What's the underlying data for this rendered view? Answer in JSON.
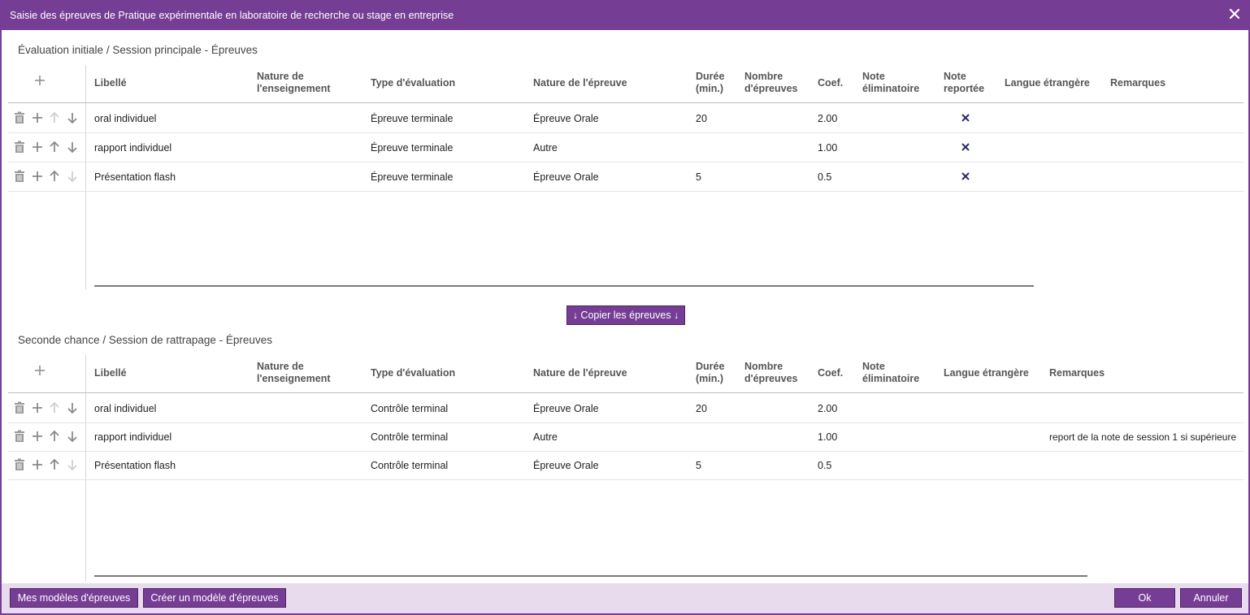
{
  "window": {
    "title": "Saisie des épreuves de Pratique expérimentale en laboratoire de recherche ou stage en entreprise"
  },
  "section1": {
    "title": "Évaluation initiale / Session principale - Épreuves",
    "headers": {
      "libelle": "Libellé",
      "nature_ens_1": "Nature de",
      "nature_ens_2": "l'enseignement",
      "type_eval": "Type d'évaluation",
      "nature_epreuve": "Nature de l'épreuve",
      "duree_1": "Durée",
      "duree_2": "(min.)",
      "nombre_1": "Nombre",
      "nombre_2": "d'épreuves",
      "coef": "Coef.",
      "note_elim_1": "Note",
      "note_elim_2": "éliminatoire",
      "note_rep_1": "Note",
      "note_rep_2": "reportée",
      "langue": "Langue étrangère",
      "remarques": "Remarques"
    },
    "rows": [
      {
        "libelle": "oral individuel",
        "nature_ens": "",
        "type_eval": "Épreuve terminale",
        "nature_epreuve": "Épreuve Orale",
        "duree": "20",
        "nombre": "",
        "coef": "2.00",
        "note_elim": "",
        "langue": "",
        "remarques": ""
      },
      {
        "libelle": "rapport individuel",
        "nature_ens": "",
        "type_eval": "Épreuve terminale",
        "nature_epreuve": "Autre",
        "duree": "",
        "nombre": "",
        "coef": "1.00",
        "note_elim": "",
        "langue": "",
        "remarques": ""
      },
      {
        "libelle": "Présentation flash",
        "nature_ens": "",
        "type_eval": "Épreuve terminale",
        "nature_epreuve": "Épreuve Orale",
        "duree": "5",
        "nombre": "",
        "coef": "0.5",
        "note_elim": "",
        "langue": "",
        "remarques": ""
      }
    ]
  },
  "copy_button": "↓ Copier les épreuves ↓",
  "section2": {
    "title": "Seconde chance / Session de rattrapage - Épreuves",
    "headers": {
      "libelle": "Libellé",
      "nature_ens_1": "Nature de",
      "nature_ens_2": "l'enseignement",
      "type_eval": "Type d'évaluation",
      "nature_epreuve": "Nature de l'épreuve",
      "duree_1": "Durée",
      "duree_2": "(min.)",
      "nombre_1": "Nombre",
      "nombre_2": "d'épreuves",
      "coef": "Coef.",
      "note_elim_1": "Note",
      "note_elim_2": "éliminatoire",
      "langue": "Langue étrangère",
      "remarques": "Remarques"
    },
    "rows": [
      {
        "libelle": "oral individuel",
        "nature_ens": "",
        "type_eval": "Contrôle terminal",
        "nature_epreuve": "Épreuve Orale",
        "duree": "20",
        "nombre": "",
        "coef": "2.00",
        "note_elim": "",
        "langue": "",
        "remarques": ""
      },
      {
        "libelle": "rapport individuel",
        "nature_ens": "",
        "type_eval": "Contrôle terminal",
        "nature_epreuve": "Autre",
        "duree": "",
        "nombre": "",
        "coef": "1.00",
        "note_elim": "",
        "langue": "",
        "remarques": "report de la note de session 1 si supérieure"
      },
      {
        "libelle": "Présentation flash",
        "nature_ens": "",
        "type_eval": "Contrôle terminal",
        "nature_epreuve": "Épreuve Orale",
        "duree": "5",
        "nombre": "",
        "coef": "0.5",
        "note_elim": "",
        "langue": "",
        "remarques": ""
      }
    ]
  },
  "footer": {
    "mes_modeles": "Mes modèles d'épreuves",
    "creer_modele": "Créer un modèle d'épreuves",
    "ok": "Ok",
    "annuler": "Annuler"
  },
  "colors": {
    "accent": "#763d94",
    "footer_bg": "#e9dbee",
    "checkmark": "#2b2b6b"
  },
  "icons": {
    "close": "close-icon",
    "add": "plus-icon",
    "delete": "trash-icon",
    "move_up": "arrow-up-icon",
    "move_down": "arrow-down-icon",
    "reported": "x-mark-icon"
  }
}
